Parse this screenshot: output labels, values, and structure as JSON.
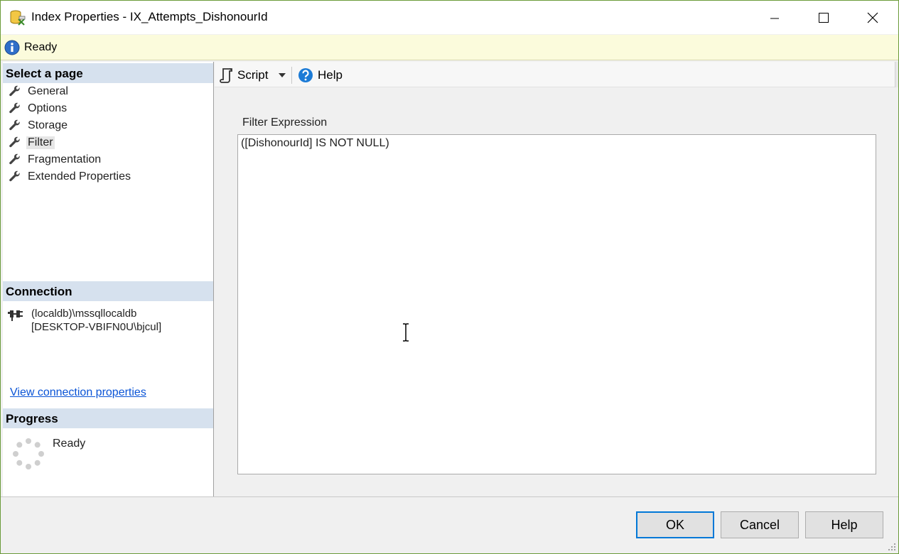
{
  "window": {
    "title": "Index Properties - IX_Attempts_DishonourId",
    "icons": {
      "app": "database-index-icon",
      "minimize": "minimize-icon",
      "maximize": "maximize-icon",
      "close": "close-icon"
    }
  },
  "status": {
    "text": "Ready",
    "icon": "info-icon"
  },
  "left_panel": {
    "select_page_header": "Select a page",
    "pages": [
      {
        "label": "General",
        "selected": false
      },
      {
        "label": "Options",
        "selected": false
      },
      {
        "label": "Storage",
        "selected": false
      },
      {
        "label": "Filter",
        "selected": true
      },
      {
        "label": "Fragmentation",
        "selected": false
      },
      {
        "label": "Extended Properties",
        "selected": false
      }
    ],
    "connection_header": "Connection",
    "connection_server": "(localdb)\\mssqllocaldb",
    "connection_user": "[DESKTOP-VBIFN0U\\bjcul]",
    "view_connection_link": "View connection properties",
    "progress_header": "Progress",
    "progress_status": "Ready"
  },
  "toolbar": {
    "script_label": "Script",
    "help_label": "Help"
  },
  "filter": {
    "label": "Filter Expression",
    "expression": "([DishonourId] IS NOT NULL)"
  },
  "buttons": {
    "ok": "OK",
    "cancel": "Cancel",
    "help": "Help"
  },
  "colors": {
    "section_header_bg": "#d6e1ee",
    "status_bar_bg": "#fbfbdc",
    "link": "#0a54d6",
    "focus_border": "#0078d7",
    "window_border": "#6b9b3a"
  }
}
